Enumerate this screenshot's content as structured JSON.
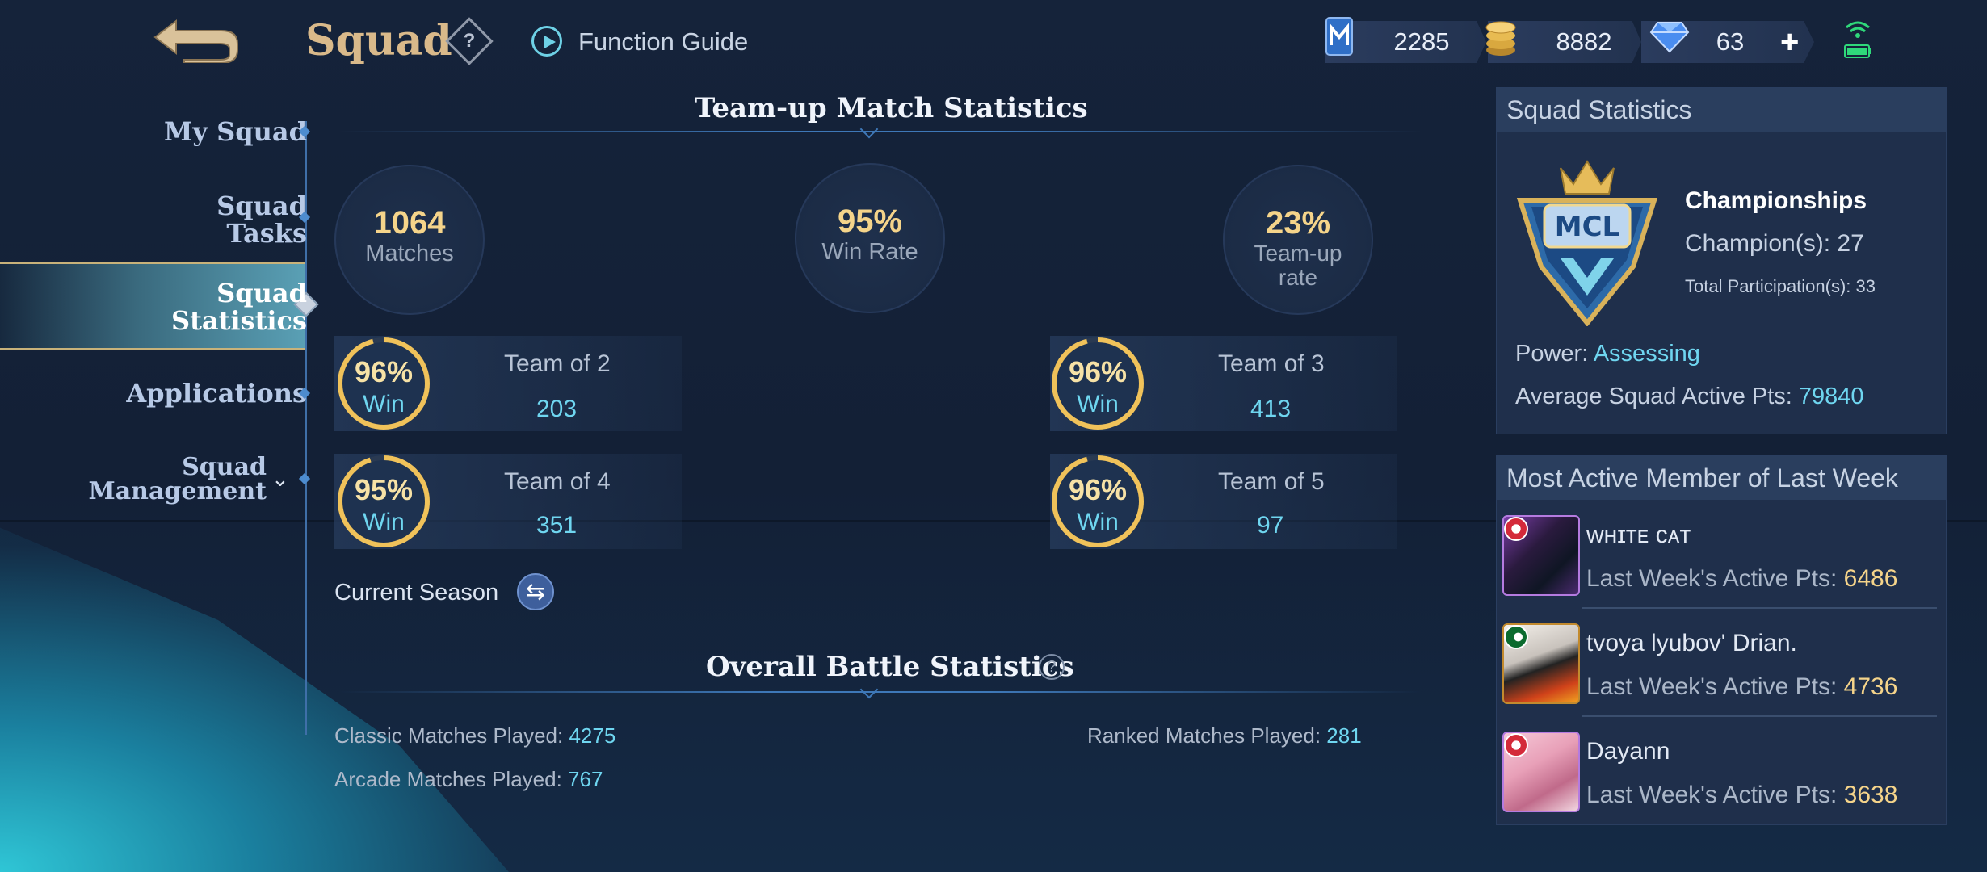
{
  "header": {
    "title": "Squad",
    "help_symbol": "?",
    "function_guide": "Function Guide",
    "currencies": [
      {
        "icon": "m-ticket-icon",
        "value": "2285"
      },
      {
        "icon": "gold-coins-icon",
        "value": "8882"
      },
      {
        "icon": "diamond-icon",
        "value": "63"
      }
    ],
    "plus": "+"
  },
  "sidebar": {
    "items": [
      {
        "label": "My Squad"
      },
      {
        "label": "Squad\nTasks"
      },
      {
        "label": "Squad\nStatistics",
        "active": true
      },
      {
        "label": "Applications"
      },
      {
        "label": "Squad\nManagement"
      }
    ]
  },
  "teamup": {
    "heading": "Team-up Match Statistics",
    "summary": [
      {
        "value": "1064",
        "label": "Matches"
      },
      {
        "value": "95%",
        "label": "Win Rate"
      },
      {
        "value": "23%",
        "label": "Team-up\nrate"
      }
    ],
    "teams": [
      {
        "pct": "96%",
        "win": "Win",
        "name": "Team of 2",
        "value": "203",
        "fraction": 0.96
      },
      {
        "pct": "96%",
        "win": "Win",
        "name": "Team of 3",
        "value": "413",
        "fraction": 0.96
      },
      {
        "pct": "95%",
        "win": "Win",
        "name": "Team of 4",
        "value": "351",
        "fraction": 0.95
      },
      {
        "pct": "96%",
        "win": "Win",
        "name": "Team of 5",
        "value": "97",
        "fraction": 0.96
      }
    ],
    "season_label": "Current Season"
  },
  "overall": {
    "heading": "Overall Battle Statistics",
    "classic_label": "Classic Matches Played: ",
    "classic_value": "4275",
    "ranked_label": "Ranked Matches Played: ",
    "ranked_value": "281",
    "arcade_label": "Arcade Matches Played: ",
    "arcade_value": "767"
  },
  "squad_stats": {
    "heading": "Squad Statistics",
    "badge_text": "MCL",
    "championships": "Championships",
    "champions": "Champion(s): 27",
    "participation": "Total Participation(s): 33",
    "power_label": "Power: ",
    "power_value": "Assessing",
    "avg_label": "Average Squad Active Pts: ",
    "avg_value": "79840"
  },
  "active_members": {
    "heading": "Most Active Member of Last Week",
    "pts_label": "Last Week's Active Pts: ",
    "members": [
      {
        "name": "ᴡʜɪᴛᴇ ᴄᴀᴛ",
        "pts": "6486"
      },
      {
        "name": "tvoya lyubov' Drian.",
        "pts": "4736"
      },
      {
        "name": "Dayann",
        "pts": "3638"
      }
    ]
  },
  "colors": {
    "accent": "#6fd6f0",
    "gold": "#f5d48a",
    "title": "#d9b98a"
  }
}
